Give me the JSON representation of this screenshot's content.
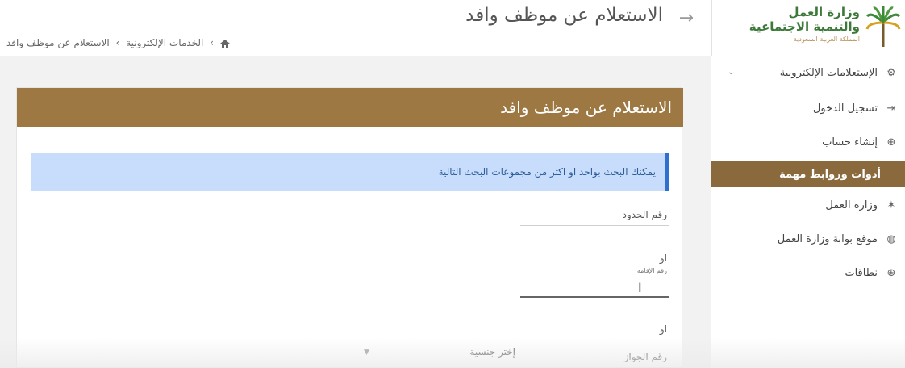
{
  "logo": {
    "line1": "وزارة العمل",
    "line2": "والتنمية الاجتماعية",
    "line3": "المملكة العربية السعودية",
    "icon": "palm-tree-icon"
  },
  "header": {
    "title": "الاستعلام عن موظف وافد",
    "back_icon": "arrow-right-icon"
  },
  "breadcrumb": {
    "items": [
      "الخدمات الإلكترونية",
      "الاستعلام عن موظف وافد"
    ],
    "separator": "›"
  },
  "sidebar": {
    "items": [
      {
        "label": "الإستعلامات الإلكترونية",
        "icon": "gears-icon"
      },
      {
        "label": "تسجيل الدخول",
        "icon": "login-icon"
      },
      {
        "label": "إنشاء حساب",
        "icon": "plus-circle-icon"
      }
    ],
    "section_label": "أدوات وروابط مهمة",
    "links": [
      {
        "label": "وزارة العمل",
        "icon": "palm-icon"
      },
      {
        "label": "موقع بوابة وزارة العمل",
        "icon": "globe-icon"
      },
      {
        "label": "نطاقات",
        "icon": "plus-circle-icon"
      }
    ]
  },
  "form": {
    "card_title": "الاستعلام عن موظف وافد",
    "alert": "يمكنك البحث بواحد او اكثر من مجموعات البحث التالية",
    "border_number_label": "رقم الحدود",
    "or_label": "او",
    "iqama_label": "رقم الإقامة",
    "passport_label": "رقم الجواز",
    "nationality_placeholder": "إختر جنسية"
  },
  "colors": {
    "brown_header": "#9d7843",
    "sidebar_section": "#8a6a3c",
    "alert_bg": "#c7ddfb",
    "alert_border": "#2f6fd0",
    "logo_green": "#3d7a3a"
  }
}
